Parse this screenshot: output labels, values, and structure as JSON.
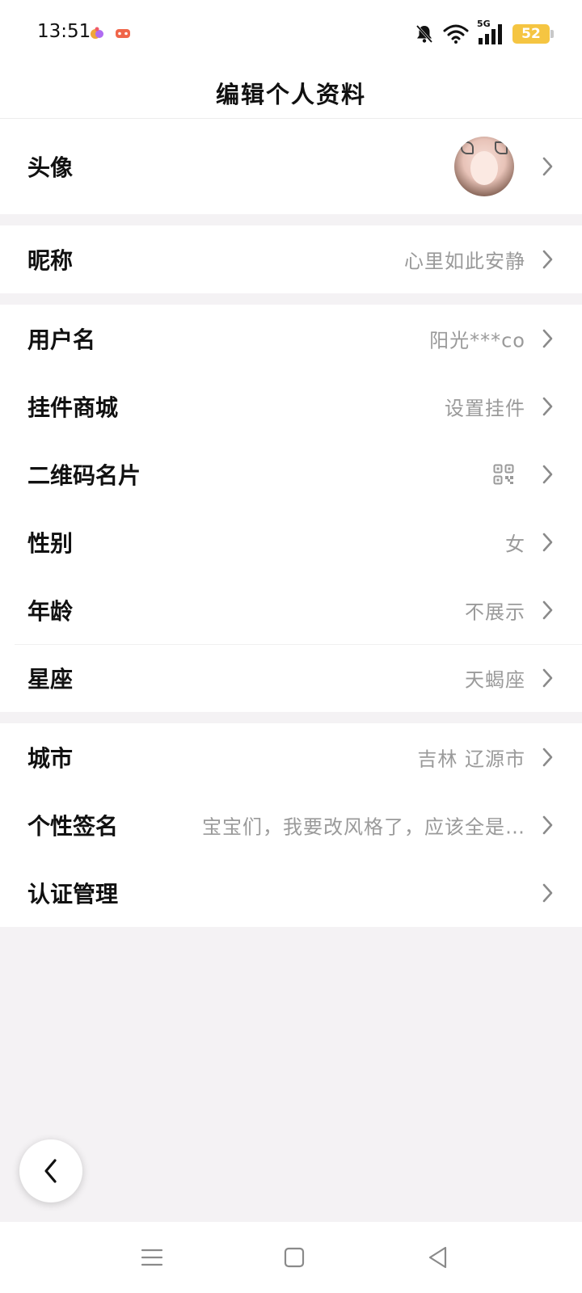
{
  "status_bar": {
    "time": "13:51",
    "network": "5G",
    "battery": "52"
  },
  "header": {
    "title": "编辑个人资料"
  },
  "profile": {
    "avatar_label": "头像",
    "nickname_label": "昵称",
    "nickname_value": "心里如此安静",
    "username_label": "用户名",
    "username_value": "阳光***co",
    "pendant_label": "挂件商城",
    "pendant_value": "设置挂件",
    "qrcode_label": "二维码名片",
    "gender_label": "性别",
    "gender_value": "女",
    "age_label": "年龄",
    "age_value": "不展示",
    "zodiac_label": "星座",
    "zodiac_value": "天蝎座",
    "city_label": "城市",
    "city_value": "吉林 辽源市",
    "signature_label": "个性签名",
    "signature_value": "宝宝们，我要改风格了，应该全是…",
    "verify_label": "认证管理"
  },
  "icons": {
    "chevron": "chevron-right-icon",
    "back": "chevron-left-icon",
    "qr": "qr-code-icon"
  },
  "colors": {
    "battery": "#f5c542",
    "secondary_text": "#9a9a9a",
    "page_bg": "#f4f2f4"
  }
}
